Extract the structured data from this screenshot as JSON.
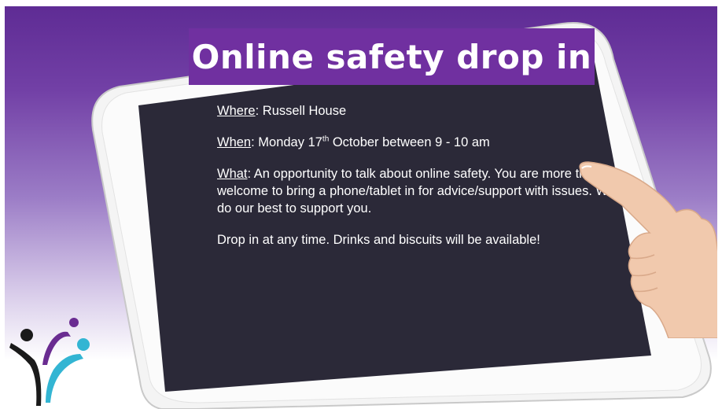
{
  "title": "Online safety drop in",
  "where": {
    "label": "Where",
    "value": ": Russell House"
  },
  "when": {
    "label": "When",
    "value_pre": ": Monday 17",
    "superscript": "th",
    "value_post": " October between 9 - 10 am"
  },
  "what": {
    "label": "What",
    "value": ": An opportunity to talk about online safety. You are more than welcome to bring a phone/tablet in for advice/support with issues. We will do our best to support you."
  },
  "drop_in": "Drop in at any time. Drinks and biscuits will be available!",
  "colors": {
    "title_bg": "#7030a0",
    "screen": "#2b2938",
    "bezel": "#f4f4f4"
  },
  "icons": {
    "logo": "charity-logo-icon",
    "hand": "pointing-hand-icon"
  }
}
